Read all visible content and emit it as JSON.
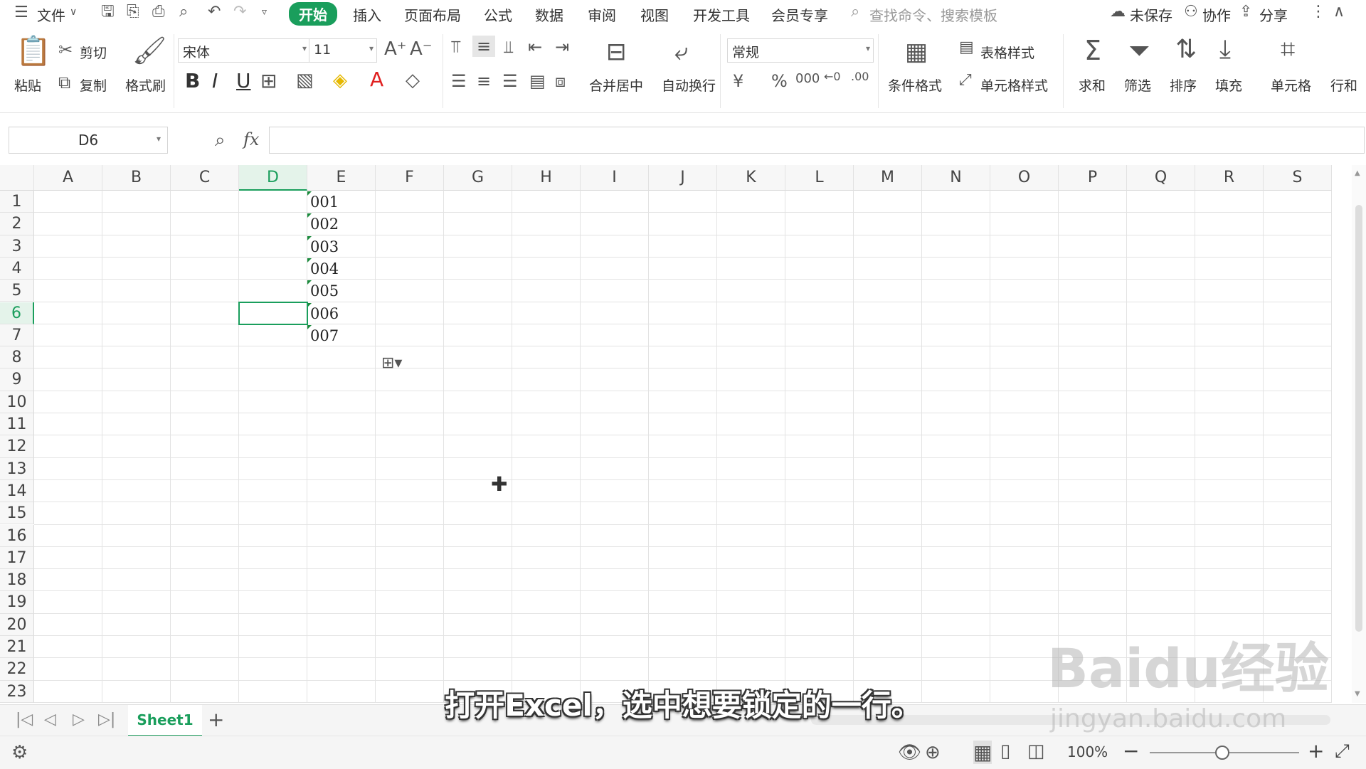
{
  "menu": {
    "hamburger_label": "文件",
    "tabs": [
      "开始",
      "插入",
      "页面布局",
      "公式",
      "数据",
      "审阅",
      "视图",
      "开发工具",
      "会员专享"
    ],
    "active_tab": "开始",
    "search_placeholder": "查找命令、搜索模板",
    "unsaved_label": "未保存",
    "collab_label": "协作",
    "share_label": "分享"
  },
  "ribbon": {
    "paste_label": "粘贴",
    "cut_label": "剪切",
    "copy_label": "复制",
    "format_painter_label": "格式刷",
    "font_name": "宋体",
    "font_size": "11",
    "merge_center_label": "合并居中",
    "wrap_text_label": "自动换行",
    "number_format": "常规",
    "conditional_format_label": "条件格式",
    "table_style_label": "表格样式",
    "cell_style_label": "单元格样式",
    "sum_label": "求和",
    "filter_label": "筛选",
    "sort_label": "排序",
    "fill_label": "填充",
    "cell_label": "单元格",
    "rowcol_label": "行和"
  },
  "formula_bar": {
    "name_box": "D6",
    "fx_label": "fx",
    "formula": ""
  },
  "grid": {
    "columns": [
      "A",
      "B",
      "C",
      "D",
      "E",
      "F",
      "G",
      "H",
      "I",
      "J",
      "K",
      "L",
      "M",
      "N",
      "O",
      "P",
      "Q",
      "R",
      "S"
    ],
    "selected_column": "D",
    "rows": [
      "1",
      "2",
      "3",
      "4",
      "5",
      "6",
      "7",
      "8",
      "9",
      "10",
      "11",
      "12",
      "13",
      "14",
      "15",
      "16",
      "17",
      "18",
      "19",
      "20",
      "21",
      "22",
      "23"
    ],
    "selected_row": "6",
    "column_e_values": [
      "001",
      "002",
      "003",
      "004",
      "005",
      "006",
      "007"
    ]
  },
  "sheets": {
    "tabs": [
      "Sheet1"
    ],
    "active": "Sheet1"
  },
  "status": {
    "zoom": "100%"
  },
  "subtitle": "打开Excel，选中想要锁定的一行。",
  "watermark": {
    "brand": "Baidu经验",
    "url": "jingyan.baidu.com"
  },
  "colors": {
    "accent": "#1a9e5c",
    "selection_border": "#1a9e5c",
    "header_bg": "#f7f7f7"
  }
}
